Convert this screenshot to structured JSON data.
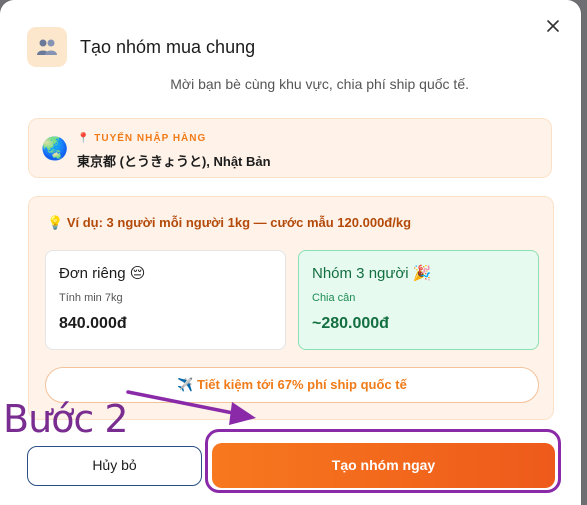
{
  "dialog": {
    "title": "Tạo nhóm mua chung",
    "subtitle": "Mời bạn bè cùng khu vực, chia phí ship quốc tế.",
    "close_icon": "close-icon",
    "header_icon": "people-icon"
  },
  "route": {
    "icon": "globe-icon",
    "label": "TUYẾN NHẬP HÀNG",
    "value": "東京都 (とうきょうと), Nhật Bản"
  },
  "example": {
    "title": "Ví dụ: 3 người mỗi người 1kg — cước mẫu 120.000đ/kg",
    "single": {
      "title": "Đơn riêng",
      "sub": "Tính min 7kg",
      "price": "840.000đ"
    },
    "group": {
      "title": "Nhóm 3 người",
      "sub": "Chia cân",
      "price": "~280.000đ"
    },
    "saving": "Tiết kiệm tới 67% phí ship quốc tế"
  },
  "buttons": {
    "cancel": "Hủy bỏ",
    "create": "Tạo nhóm ngay"
  },
  "annotation": {
    "text": "Bước 2",
    "color": "#8a2aa8"
  },
  "colors": {
    "accent": "#f07b19",
    "group_green": "#136f41"
  }
}
